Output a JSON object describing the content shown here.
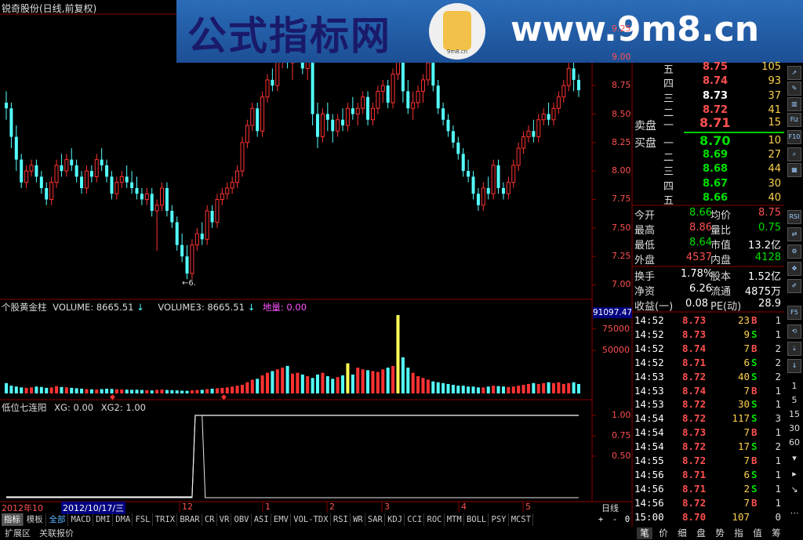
{
  "window": {
    "title": "锐奇股份(日线,前复权)"
  },
  "banner": {
    "title": "公式指标网",
    "url": "www.9m8.cn",
    "seal_text": "9m8.cn"
  },
  "price_axis": {
    "labels": [
      "9.25",
      "9.00",
      "8.75",
      "8.50",
      "8.25",
      "8.00",
      "7.75",
      "7.50",
      "7.25",
      "7.00"
    ],
    "min": 6.9,
    "max": 9.35
  },
  "low_marker": {
    "text": "←6."
  },
  "candles": [
    [
      8.6,
      8.7,
      8.45,
      8.55
    ],
    [
      8.55,
      8.6,
      8.2,
      8.3
    ],
    [
      8.3,
      8.4,
      8.0,
      8.1
    ],
    [
      8.1,
      8.15,
      7.85,
      7.9
    ],
    [
      7.9,
      8.05,
      7.85,
      8.0
    ],
    [
      8.0,
      8.1,
      7.95,
      8.05
    ],
    [
      8.05,
      8.1,
      7.9,
      7.95
    ],
    [
      7.95,
      8.0,
      7.8,
      7.85
    ],
    [
      7.85,
      7.9,
      7.7,
      7.75
    ],
    [
      7.75,
      7.95,
      7.7,
      7.9
    ],
    [
      7.9,
      8.1,
      7.85,
      8.05
    ],
    [
      8.05,
      8.15,
      7.95,
      8.0
    ],
    [
      8.0,
      8.15,
      7.95,
      8.1
    ],
    [
      8.1,
      8.2,
      8.0,
      8.05
    ],
    [
      8.05,
      8.1,
      7.9,
      7.95
    ],
    [
      7.95,
      8.0,
      7.8,
      7.85
    ],
    [
      7.85,
      8.05,
      7.8,
      8.0
    ],
    [
      8.0,
      8.05,
      7.9,
      7.95
    ],
    [
      7.95,
      8.15,
      7.9,
      8.1
    ],
    [
      8.1,
      8.2,
      8.0,
      8.05
    ],
    [
      8.05,
      8.1,
      7.9,
      7.95
    ],
    [
      7.95,
      8.0,
      7.75,
      7.8
    ],
    [
      7.8,
      7.95,
      7.75,
      7.9
    ],
    [
      7.9,
      8.0,
      7.85,
      7.95
    ],
    [
      7.95,
      8.05,
      7.85,
      7.9
    ],
    [
      7.9,
      8.0,
      7.8,
      7.85
    ],
    [
      7.85,
      7.95,
      7.75,
      7.8
    ],
    [
      7.8,
      7.85,
      7.7,
      7.75
    ],
    [
      7.75,
      7.85,
      7.7,
      7.8
    ],
    [
      7.8,
      7.85,
      7.6,
      7.65
    ],
    [
      7.65,
      7.75,
      7.3,
      7.7
    ],
    [
      7.7,
      7.9,
      7.65,
      7.85
    ],
    [
      7.85,
      7.9,
      7.6,
      7.65
    ],
    [
      7.65,
      7.7,
      7.5,
      7.55
    ],
    [
      7.55,
      7.6,
      7.3,
      7.35
    ],
    [
      7.35,
      7.45,
      7.2,
      7.25
    ],
    [
      7.25,
      7.35,
      7.05,
      7.1
    ],
    [
      7.1,
      7.4,
      7.05,
      7.35
    ],
    [
      7.35,
      7.5,
      7.3,
      7.45
    ],
    [
      7.45,
      7.55,
      7.35,
      7.4
    ],
    [
      7.4,
      7.7,
      7.35,
      7.65
    ],
    [
      7.65,
      7.7,
      7.5,
      7.55
    ],
    [
      7.55,
      7.8,
      7.5,
      7.75
    ],
    [
      7.75,
      7.85,
      7.7,
      7.8
    ],
    [
      7.8,
      7.9,
      7.75,
      7.85
    ],
    [
      7.85,
      7.95,
      7.8,
      7.9
    ],
    [
      7.9,
      8.05,
      7.85,
      8.0
    ],
    [
      8.0,
      8.3,
      7.95,
      8.25
    ],
    [
      8.25,
      8.45,
      8.2,
      8.4
    ],
    [
      8.4,
      8.6,
      8.35,
      8.55
    ],
    [
      8.55,
      8.6,
      8.3,
      8.35
    ],
    [
      8.35,
      8.7,
      8.3,
      8.65
    ],
    [
      8.65,
      8.85,
      8.6,
      8.8
    ],
    [
      8.8,
      8.9,
      8.7,
      8.75
    ],
    [
      8.75,
      9.05,
      8.7,
      9.0
    ],
    [
      9.0,
      9.2,
      8.9,
      9.1
    ],
    [
      9.1,
      9.35,
      8.9,
      8.95
    ],
    [
      8.95,
      9.1,
      8.8,
      9.05
    ],
    [
      9.05,
      9.2,
      8.95,
      9.15
    ],
    [
      9.15,
      9.3,
      8.85,
      8.9
    ],
    [
      8.9,
      9.1,
      8.8,
      9.0
    ],
    [
      9.0,
      9.05,
      8.4,
      8.5
    ],
    [
      8.5,
      8.6,
      8.2,
      8.3
    ],
    [
      8.3,
      8.55,
      8.25,
      8.5
    ],
    [
      8.5,
      8.6,
      8.35,
      8.45
    ],
    [
      8.45,
      8.5,
      8.25,
      8.35
    ],
    [
      8.35,
      8.5,
      8.3,
      8.45
    ],
    [
      8.45,
      8.55,
      8.35,
      8.4
    ],
    [
      8.4,
      8.6,
      8.35,
      8.55
    ],
    [
      8.55,
      8.65,
      8.45,
      8.5
    ],
    [
      8.5,
      8.6,
      8.4,
      8.55
    ],
    [
      8.55,
      8.7,
      8.5,
      8.65
    ],
    [
      8.65,
      8.7,
      8.4,
      8.45
    ],
    [
      8.45,
      8.6,
      8.4,
      8.55
    ],
    [
      8.55,
      8.75,
      8.5,
      8.7
    ],
    [
      8.7,
      8.8,
      8.6,
      8.75
    ],
    [
      8.75,
      8.8,
      8.55,
      8.6
    ],
    [
      8.6,
      8.9,
      8.55,
      8.85
    ],
    [
      8.85,
      9.35,
      8.8,
      9.25
    ],
    [
      9.25,
      9.3,
      8.6,
      8.7
    ],
    [
      8.7,
      8.8,
      8.5,
      8.55
    ],
    [
      8.55,
      8.7,
      8.45,
      8.6
    ],
    [
      8.6,
      8.75,
      8.55,
      8.7
    ],
    [
      8.7,
      8.85,
      8.6,
      8.8
    ],
    [
      8.8,
      9.0,
      8.75,
      8.95
    ],
    [
      8.95,
      9.0,
      8.7,
      8.75
    ],
    [
      8.75,
      8.8,
      8.5,
      8.55
    ],
    [
      8.55,
      8.6,
      8.4,
      8.45
    ],
    [
      8.45,
      8.5,
      8.3,
      8.35
    ],
    [
      8.35,
      8.4,
      8.2,
      8.25
    ],
    [
      8.25,
      8.3,
      8.1,
      8.15
    ],
    [
      8.15,
      8.2,
      7.95,
      8.0
    ],
    [
      8.0,
      8.1,
      7.9,
      7.95
    ],
    [
      7.95,
      8.0,
      7.75,
      7.8
    ],
    [
      7.8,
      7.85,
      7.65,
      7.7
    ],
    [
      7.7,
      7.9,
      7.65,
      7.85
    ],
    [
      7.85,
      7.95,
      7.75,
      7.8
    ],
    [
      7.8,
      8.1,
      7.75,
      8.05
    ],
    [
      8.05,
      8.1,
      7.8,
      7.85
    ],
    [
      7.85,
      7.9,
      7.75,
      7.8
    ],
    [
      7.8,
      7.95,
      7.75,
      7.9
    ],
    [
      7.9,
      8.1,
      7.85,
      8.05
    ],
    [
      8.05,
      8.25,
      8.0,
      8.2
    ],
    [
      8.2,
      8.35,
      8.15,
      8.3
    ],
    [
      8.3,
      8.4,
      8.25,
      8.35
    ],
    [
      8.35,
      8.45,
      8.25,
      8.3
    ],
    [
      8.3,
      8.5,
      8.25,
      8.45
    ],
    [
      8.45,
      8.55,
      8.4,
      8.5
    ],
    [
      8.5,
      8.6,
      8.4,
      8.45
    ],
    [
      8.45,
      8.6,
      8.4,
      8.55
    ],
    [
      8.55,
      8.7,
      8.5,
      8.65
    ],
    [
      8.65,
      8.8,
      8.6,
      8.75
    ],
    [
      8.75,
      8.95,
      8.7,
      8.9
    ],
    [
      8.9,
      8.95,
      8.7,
      8.8
    ],
    [
      8.8,
      8.85,
      8.65,
      8.71
    ]
  ],
  "volume": {
    "title": "个股黄金柱",
    "vol_label": "VOLUME: 8665.51",
    "vol3_label": "VOLUME3: 8665.51",
    "dl_label": "地量: 0.00",
    "axis_labels": [
      "75000",
      "50000"
    ],
    "max_badge": "91097.47",
    "max": 91097.47,
    "values": [
      12000,
      9000,
      8000,
      7000,
      6500,
      7000,
      8000,
      7500,
      6500,
      7000,
      8500,
      7500,
      7000,
      6500,
      6000,
      5500,
      5000,
      4800,
      4500,
      5000,
      5500,
      5200,
      4800,
      4600,
      4400,
      4200,
      4300,
      4000,
      3800,
      3500,
      4200,
      4500,
      4000,
      3800,
      3500,
      3200,
      3000,
      3600,
      4000,
      4200,
      5000,
      5500,
      6000,
      6500,
      7000,
      8000,
      9000,
      10000,
      13000,
      16000,
      17000,
      21000,
      24000,
      26000,
      28000,
      30000,
      32000,
      23000,
      24000,
      22000,
      20000,
      18000,
      22000,
      24000,
      20000,
      17000,
      19000,
      21000,
      35000,
      22000,
      30000,
      28000,
      27000,
      26000,
      25000,
      28000,
      30000,
      32000,
      91097,
      42000,
      30000,
      24000,
      20000,
      18000,
      16000,
      14000,
      13000,
      12000,
      11000,
      10000,
      9000,
      9000,
      8000,
      8000,
      7000,
      7000,
      8000,
      9000,
      8500,
      8000,
      7500,
      8000,
      9000,
      10000,
      11000,
      12000,
      11000,
      12000,
      13000,
      12000,
      13000,
      11000,
      12000,
      13000,
      11000
    ],
    "gold_bars": [
      68,
      78
    ]
  },
  "indicator": {
    "title": "低位七连阳",
    "xg_label": "XG: 0.00",
    "xg2_label": "XG2: 1.00",
    "axis_labels": [
      "1.00",
      "0.75",
      "0.50"
    ],
    "pulse_start": 37,
    "pulse_end": 39
  },
  "date_bar": {
    "year_label": "2012年10",
    "cursor_date": "2012/10/17/三",
    "month_labels": [
      "12",
      "1",
      "2",
      "3",
      "4",
      "5"
    ],
    "period": "日线"
  },
  "indicator_tabs": {
    "active": "指标",
    "items": [
      "指标",
      "模板",
      "全部",
      "MACD",
      "DMI",
      "DMA",
      "FSL",
      "TRIX",
      "BRAR",
      "CR",
      "VR",
      "OBV",
      "ASI",
      "EMV",
      "VOL-TDX",
      "RSI",
      "WR",
      "SAR",
      "KDJ",
      "CCI",
      "ROC",
      "MTM",
      "BOLL",
      "PSY",
      "MCST"
    ],
    "controls": [
      "+",
      "-",
      "0"
    ]
  },
  "bottom_tabs": [
    "扩展区",
    "关联报价"
  ],
  "order_book": {
    "asks": [
      {
        "level": "五",
        "price": "8.75",
        "vol": "105"
      },
      {
        "level": "四",
        "price": "8.74",
        "vol": "93"
      },
      {
        "level": "三",
        "price": "8.73",
        "vol": "37"
      },
      {
        "level": "二",
        "price": "8.72",
        "vol": "41"
      },
      {
        "level": "一",
        "price": "8.71",
        "vol": "15"
      }
    ],
    "bids": [
      {
        "level": "一",
        "price": "8.70",
        "vol": "10"
      },
      {
        "level": "二",
        "price": "8.69",
        "vol": "27"
      },
      {
        "level": "三",
        "price": "8.68",
        "vol": "44"
      },
      {
        "level": "四",
        "price": "8.67",
        "vol": "30"
      },
      {
        "level": "五",
        "price": "8.66",
        "vol": "40"
      }
    ],
    "sell_label": "卖盘",
    "buy_label": "买盘"
  },
  "stats": [
    [
      {
        "k": "今开",
        "v": "8.66"
      },
      {
        "k": "均价",
        "v": "8.75"
      }
    ],
    [
      {
        "k": "最高",
        "v": "8.86"
      },
      {
        "k": "量比",
        "v": "0.75"
      }
    ],
    [
      {
        "k": "最低",
        "v": "8.64"
      },
      {
        "k": "市值",
        "v": "13.2亿"
      }
    ],
    [
      {
        "k": "外盘",
        "v": "4537"
      },
      {
        "k": "内盘",
        "v": "4128"
      }
    ],
    [
      {
        "k": "换手",
        "v": "1.78%"
      },
      {
        "k": "股本",
        "v": "1.52亿"
      }
    ],
    [
      {
        "k": "净资",
        "v": "6.26"
      },
      {
        "k": "流通",
        "v": "4875万"
      }
    ],
    [
      {
        "k": "收益(一)",
        "v": "0.08"
      },
      {
        "k": "PE(动)",
        "v": "28.9"
      }
    ]
  ],
  "ticks": [
    {
      "time": "14:52",
      "price": "8.73",
      "vol": "23",
      "bs": "B",
      "n": "1"
    },
    {
      "time": "14:52",
      "price": "8.73",
      "vol": "9",
      "bs": "S",
      "n": "1"
    },
    {
      "time": "14:52",
      "price": "8.74",
      "vol": "7",
      "bs": "B",
      "n": "2"
    },
    {
      "time": "14:52",
      "price": "8.71",
      "vol": "6",
      "bs": "S",
      "n": "2"
    },
    {
      "time": "14:53",
      "price": "8.72",
      "vol": "40",
      "bs": "S",
      "n": "2"
    },
    {
      "time": "14:53",
      "price": "8.74",
      "vol": "7",
      "bs": "B",
      "n": "1"
    },
    {
      "time": "14:53",
      "price": "8.72",
      "vol": "30",
      "bs": "S",
      "n": "1"
    },
    {
      "time": "14:54",
      "price": "8.72",
      "vol": "117",
      "bs": "S",
      "n": "3"
    },
    {
      "time": "14:54",
      "price": "8.73",
      "vol": "7",
      "bs": "B",
      "n": "1"
    },
    {
      "time": "14:54",
      "price": "8.72",
      "vol": "17",
      "bs": "S",
      "n": "2"
    },
    {
      "time": "14:55",
      "price": "8.72",
      "vol": "7",
      "bs": "B",
      "n": "1"
    },
    {
      "time": "14:56",
      "price": "8.71",
      "vol": "6",
      "bs": "S",
      "n": "1"
    },
    {
      "time": "14:56",
      "price": "8.71",
      "vol": "2",
      "bs": "S",
      "n": "1"
    },
    {
      "time": "14:56",
      "price": "8.72",
      "vol": "7",
      "bs": "B",
      "n": "1"
    },
    {
      "time": "15:00",
      "price": "8.70",
      "vol": "107",
      "bs": "",
      "n": "0"
    }
  ],
  "right_tabs": [
    "笔",
    "价",
    "细",
    "盘",
    "势",
    "指",
    "值",
    "筹"
  ],
  "side_numbers": [
    "1",
    "5",
    "15",
    "30",
    "60"
  ],
  "side_icons": [
    "cursor-icon",
    "line-chart-icon",
    "bars-icon",
    "fiz-icon",
    "f10-icon",
    "search-icon",
    "chart-icon",
    "rsi-icon",
    "swap-icon",
    "gear-icon",
    "nav-icon",
    "pencil-icon",
    "f5-icon",
    "refresh-icon",
    "down-icon",
    "down2-icon",
    "right-icon",
    "arrow-icon",
    "ellipsis-icon"
  ],
  "colors": {
    "up": "#ff3232",
    "down": "#54ffff",
    "gold": "#ffff54",
    "grid": "#8b0000",
    "accent": "#00cc00",
    "banner": "#2060a8"
  }
}
